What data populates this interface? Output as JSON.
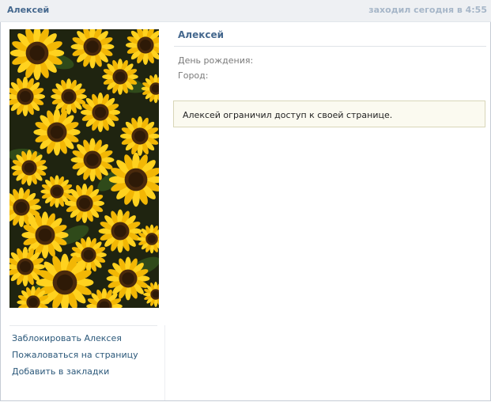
{
  "topbar": {
    "name": "Алексей",
    "status": "заходил сегодня в 4:55"
  },
  "profile": {
    "name": "Алексей",
    "info": {
      "birthday_label": "День рождения:",
      "city_label": "Город:"
    },
    "notice": "Алексей ограничил доступ к своей странице."
  },
  "actions": [
    {
      "label": "Заблокировать Алексея"
    },
    {
      "label": "Пожаловаться на страницу"
    },
    {
      "label": "Добавить в закладки"
    }
  ],
  "photo": {
    "description_icon": "sunflowers-photo"
  },
  "colors": {
    "brand": "#45688e",
    "link": "#2b587a",
    "topbar_bg": "#eef0f3",
    "status_text": "#a6b6c8",
    "notice_bg": "#fbfaf0",
    "notice_border": "#d8d6b8"
  }
}
